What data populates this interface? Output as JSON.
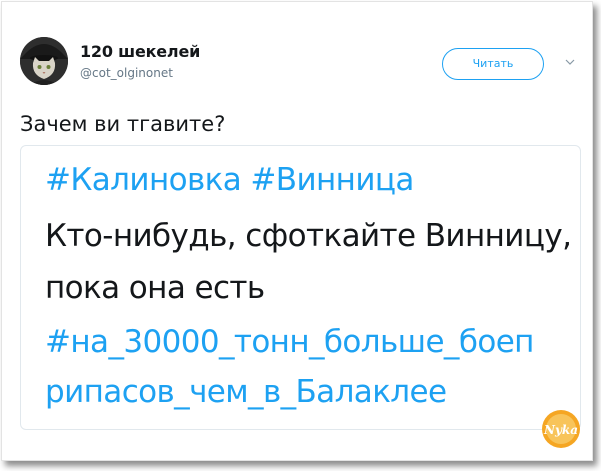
{
  "author": {
    "name": "120 шекелей",
    "handle": "@cot_olginonet",
    "avatar_icon": "cat-avatar-icon"
  },
  "follow_button": {
    "label": "Читать"
  },
  "tweet": {
    "text": "Зачем ви тгавите?"
  },
  "quoted": {
    "line1": "#Калиновка #Винница",
    "line2": "Кто-нибудь, сфоткайте Винницу,",
    "line3": "пока она есть",
    "line4": "#на_30000_тонн_больше_боеп",
    "line5": "рипасов_чем_в_Балаклее"
  },
  "watermark": {
    "text": "Nyka"
  },
  "colors": {
    "accent": "#1da1f2",
    "text": "#14171a",
    "muted": "#657786",
    "watermark": "#f5a623"
  }
}
